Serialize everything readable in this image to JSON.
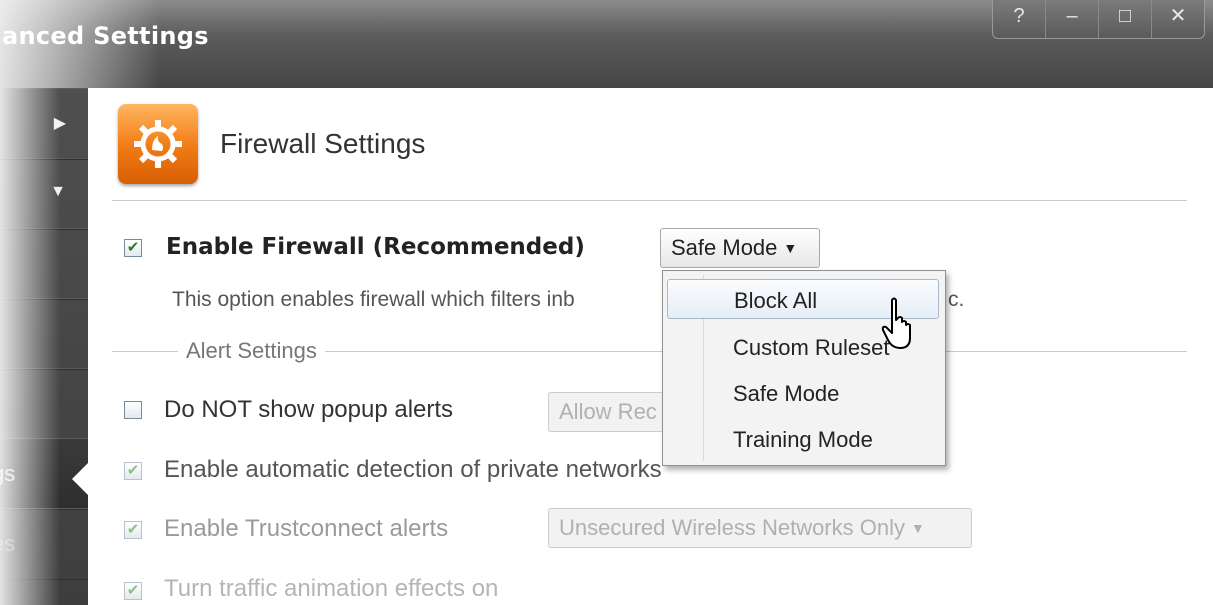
{
  "window": {
    "title": "anced Settings",
    "controls": [
      "?",
      "–",
      "□",
      "✕"
    ]
  },
  "sidebar": {
    "items": [
      {
        "label": "",
        "arrow": "▶"
      },
      {
        "label": "",
        "arrow": "▼"
      },
      {
        "label": "",
        "arrow": ""
      },
      {
        "label": "",
        "arrow": ""
      },
      {
        "label": "",
        "arrow": ""
      },
      {
        "label": "gs",
        "arrow": ""
      },
      {
        "label": "es",
        "arrow": ""
      }
    ]
  },
  "header": {
    "title": "Firewall Settings",
    "icon": "firewall-gear-icon"
  },
  "enable_firewall": {
    "label": "Enable Firewall (Recommended)",
    "checked": true,
    "mode_selected": "Safe Mode",
    "description": "This option enables firewall which filters inb",
    "description_tail": "c."
  },
  "alert_settings": {
    "group_label": "Alert Settings",
    "popup_alerts_label": "Do NOT show popup alerts",
    "popup_alerts_combo": "Allow Rec",
    "private_networks_label": "Enable automatic detection of private networks",
    "trustconnect_label": "Enable Trustconnect alerts",
    "trustconnect_combo": "Unsecured Wireless Networks Only",
    "animation_label": "Turn traffic animation effects on"
  },
  "mode_menu": {
    "items": [
      "Block All",
      "Custom Ruleset",
      "Safe Mode",
      "Training Mode"
    ],
    "hovered": "Block All"
  },
  "colors": {
    "accent_orange": "#f07a14",
    "titlebar": "#5c5c5c",
    "check_green": "#2b7a2b"
  }
}
